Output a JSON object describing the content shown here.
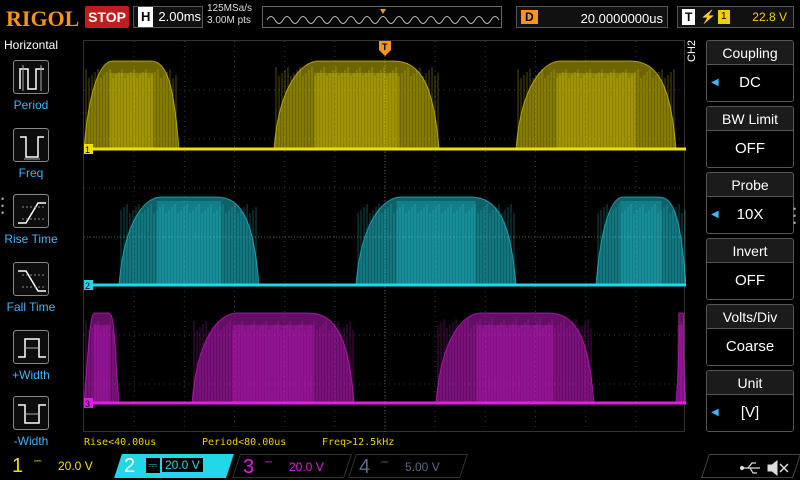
{
  "top": {
    "brand": "RIGOL",
    "run_state": "STOP",
    "h_label": "H",
    "timebase": "2.00ms",
    "sample_rate": "125MSa/s",
    "points": "3.00M pts",
    "delay_label": "D",
    "delay": "20.0000000us",
    "trig_label": "T",
    "trig_source": "1",
    "trig_level": "22.8 V"
  },
  "left_menu": {
    "title": "Horizontal",
    "items": [
      {
        "label": "Period"
      },
      {
        "label": "Freq"
      },
      {
        "label": "Rise Time"
      },
      {
        "label": "Fall Time"
      },
      {
        "label": "+Width"
      },
      {
        "label": "-Width"
      }
    ]
  },
  "right_menu": {
    "channel_tag": "CH2",
    "items": [
      {
        "title": "Coupling",
        "value": "DC"
      },
      {
        "title": "BW Limit",
        "value": "OFF"
      },
      {
        "title": "Probe",
        "value": "10X"
      },
      {
        "title": "Invert",
        "value": "OFF"
      },
      {
        "title": "Volts/Div",
        "value": "Coarse"
      },
      {
        "title": "Unit",
        "value": "[V]"
      }
    ]
  },
  "measurements": {
    "rise": "Rise<40.00us",
    "period": "Period<80.00us",
    "freq": "Freq>12.5kHz"
  },
  "channels": [
    {
      "num": "1",
      "scale": "20.0 V",
      "color": "#f0e000"
    },
    {
      "num": "2",
      "scale": "20.0 V",
      "color": "#22d8e8"
    },
    {
      "num": "3",
      "scale": "20.0 V",
      "color": "#e020e0"
    },
    {
      "num": "4",
      "scale": "5.00 V",
      "color": "#5a6a8a"
    }
  ],
  "markers": {
    "ch1": "1",
    "ch2": "2",
    "ch3": "3",
    "trigger": "T"
  },
  "colors": {
    "ch1": "#f0e000",
    "ch2": "#22d8e8",
    "ch3": "#e020e0",
    "menu_accent": "#3fb4ff",
    "brand": "#f7941d"
  },
  "icons": [
    "period-icon",
    "freq-icon",
    "rise-time-icon",
    "fall-time-icon",
    "pos-width-icon",
    "neg-width-icon",
    "usb-icon",
    "speaker-mute-icon"
  ]
}
